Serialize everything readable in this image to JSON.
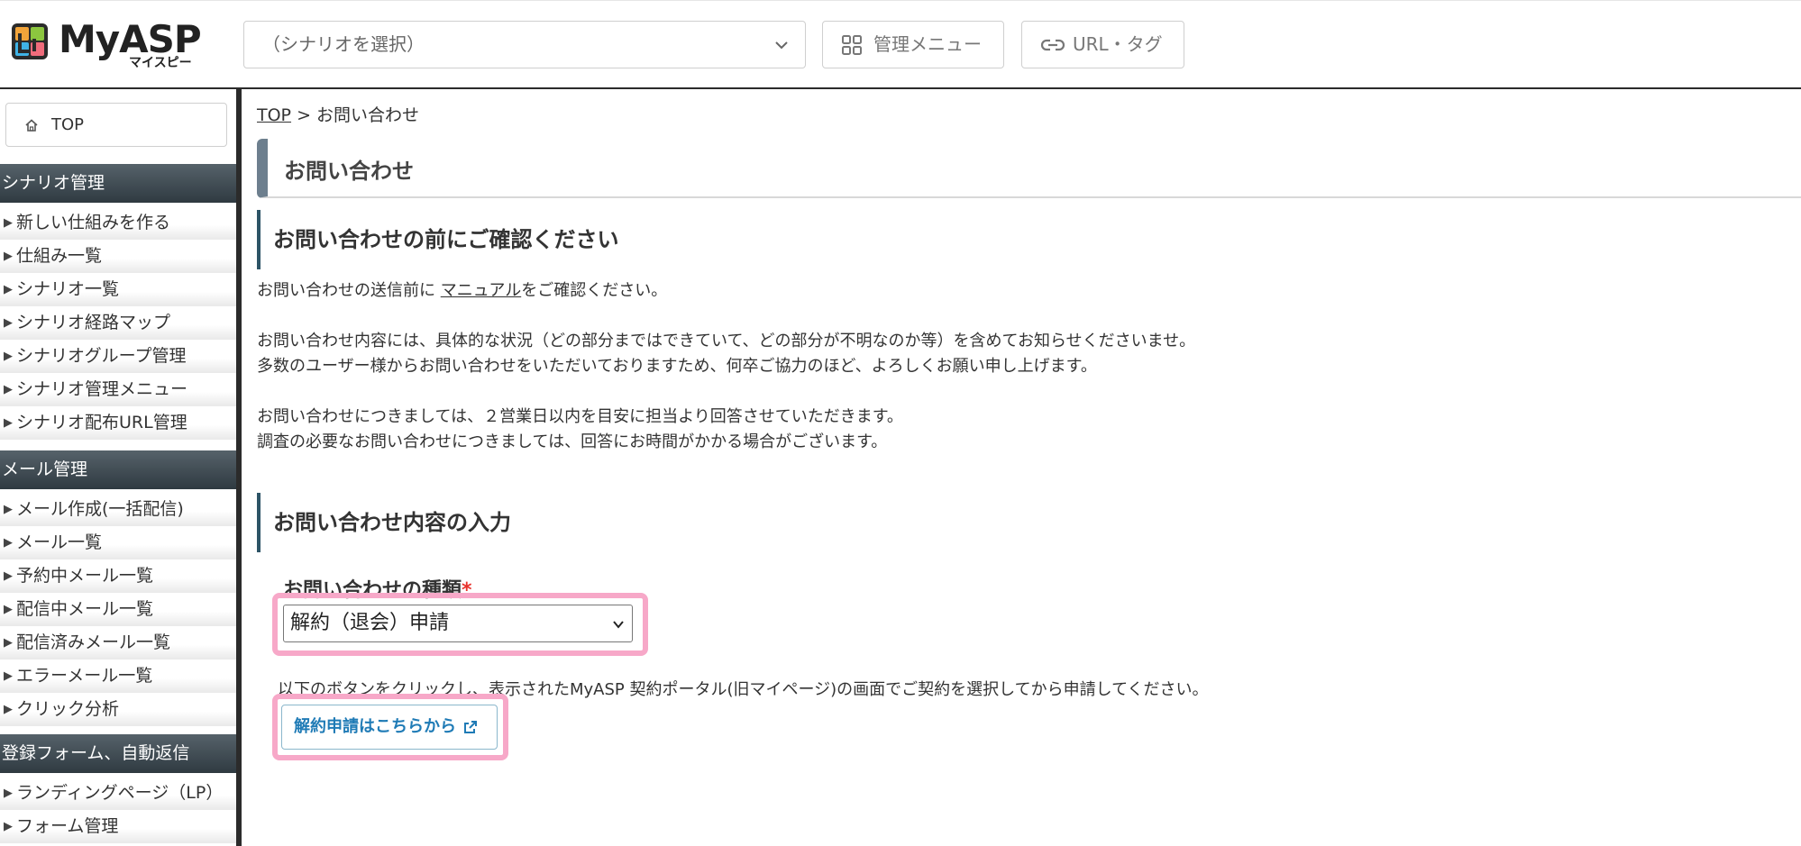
{
  "header": {
    "logo_text": "MyASP",
    "logo_sub": "マイスピー",
    "scenario_select": "（シナリオを選択）",
    "menu_button": "管理メニュー",
    "url_button": "URL・タグ"
  },
  "sidebar": {
    "top_label": "TOP",
    "sections": [
      {
        "title": "シナリオ管理",
        "items": [
          "新しい仕組みを作る",
          "仕組み一覧",
          "シナリオ一覧",
          "シナリオ経路マップ",
          "シナリオグループ管理",
          "シナリオ管理メニュー",
          "シナリオ配布URL管理"
        ]
      },
      {
        "title": "メール管理",
        "items": [
          "メール作成(一括配信)",
          "メール一覧",
          "予約中メール一覧",
          "配信中メール一覧",
          "配信済みメール一覧",
          "エラーメール一覧",
          "クリック分析"
        ]
      },
      {
        "title": "登録フォーム、自動返信",
        "items": [
          "ランディングページ（LP）",
          "フォーム管理"
        ]
      }
    ]
  },
  "main": {
    "breadcrumb_top": "TOP",
    "breadcrumb_sep": ">",
    "breadcrumb_current": "お問い合わせ",
    "page_title": "お問い合わせ",
    "section1_title": "お問い合わせの前にご確認ください",
    "p1_before": "お問い合わせの送信前に ",
    "p1_link": "マニュアル",
    "p1_after": "をご確認ください。",
    "p2_line1": "お問い合わせ内容には、具体的な状況（どの部分まではできていて、どの部分が不明なのか等）を含めてお知らせくださいませ。",
    "p2_line2": "多数のユーザー様からお問い合わせをいただいておりますため、何卒ご協力のほど、よろしくお願い申し上げます。",
    "p3_line1": "お問い合わせにつきましては、２営業日以内を目安に担当より回答させていただきます。",
    "p3_line2": "調査の必要なお問い合わせにつきましては、回答にお時間がかかる場合がございます。",
    "section2_title": "お問い合わせ内容の入力",
    "field_label": "お問い合わせの種類",
    "required_mark": "*",
    "type_value": "解約（退会）申請",
    "notice": "以下のボタンをクリックし、表示されたMyASP 契約ポータル(旧マイページ)の画面でご契約を選択してから申請してください。",
    "cancel_button": "解約申請はこちらから"
  },
  "colors": {
    "sidebar_section_bg": "#2f3a41",
    "title_accent": "#6d7f8e",
    "section_accent": "#2d5466",
    "required": "#e8322c",
    "highlight": "#f7a8c8",
    "link_button": "#1f7bb6"
  }
}
